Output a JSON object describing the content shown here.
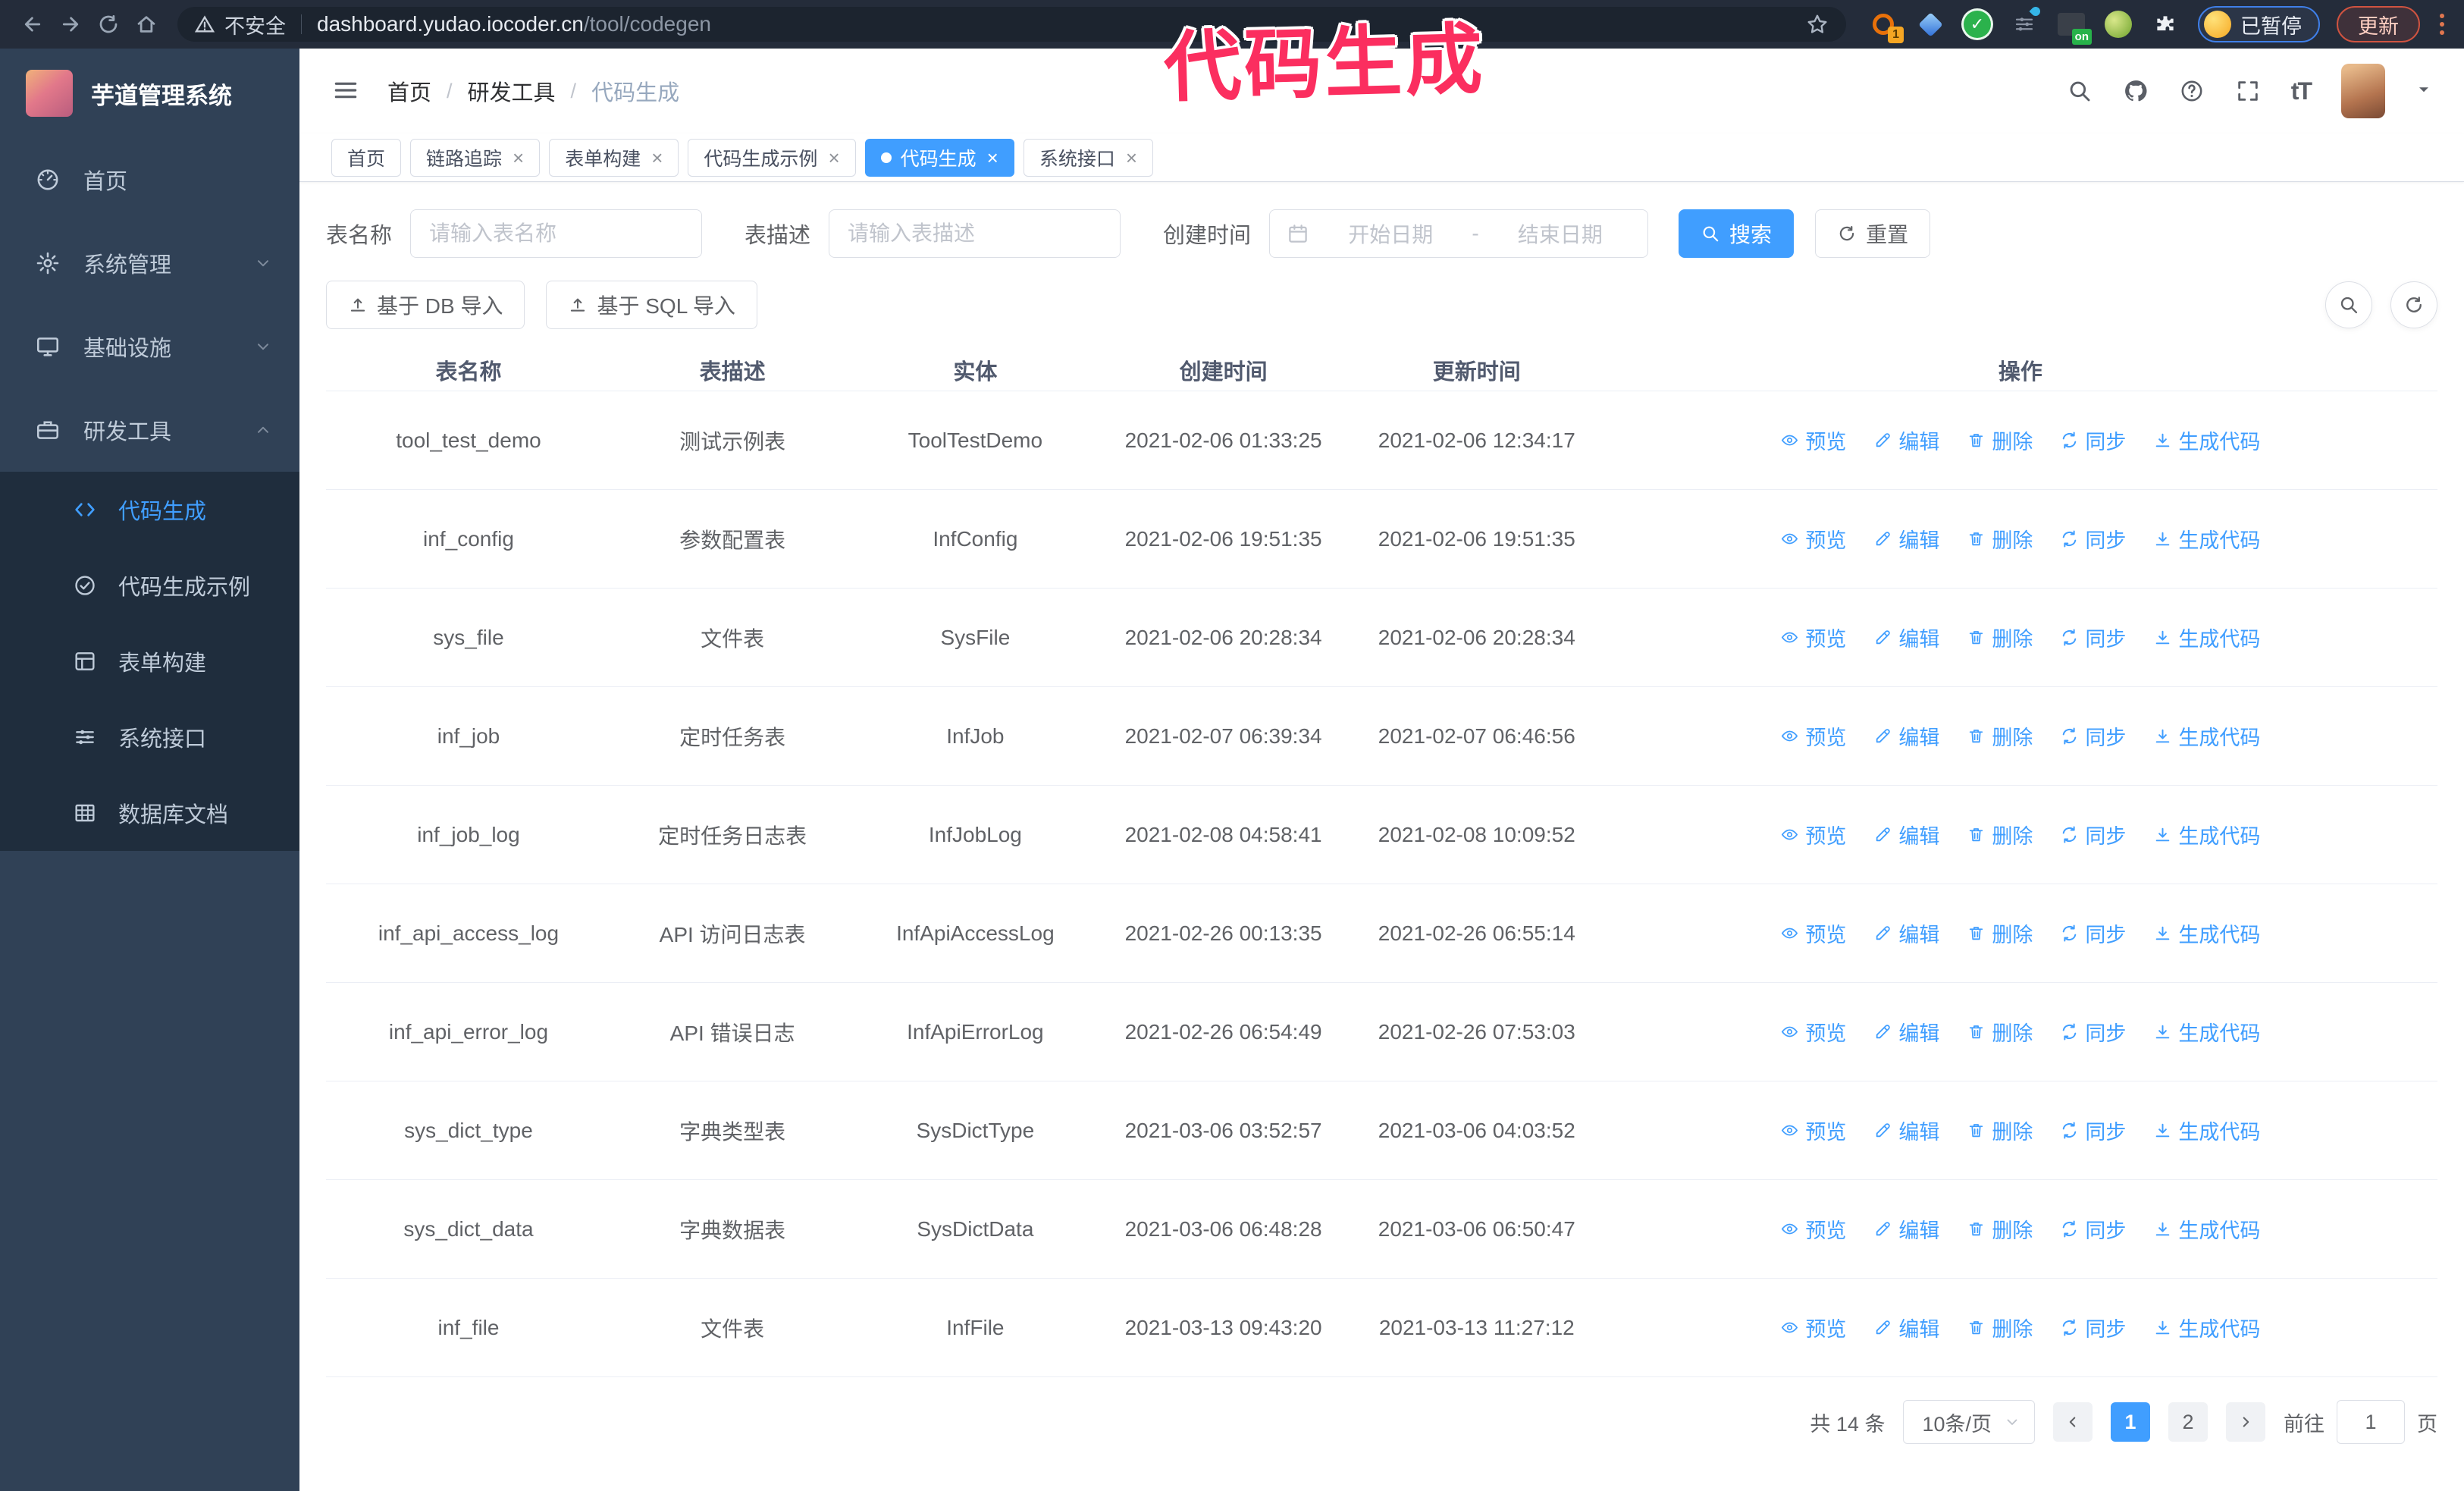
{
  "colors": {
    "accent": "#409eff",
    "sidebar": "#304156",
    "submenu": "#1f2d3d",
    "watermark": "#fb2e5f"
  },
  "watermark": "代码生成",
  "browser": {
    "security_label": "不安全",
    "url_domain": "dashboard.yudao.iocoder.cn",
    "url_path": "/tool/codegen",
    "extension_badge": "1",
    "extension_on_badge": "on",
    "profile_chip_label": "已暂停",
    "update_button_label": "更新"
  },
  "sidebar": {
    "title": "芋道管理系统",
    "items": [
      {
        "label": "首页"
      },
      {
        "label": "系统管理"
      },
      {
        "label": "基础设施"
      },
      {
        "label": "研发工具"
      }
    ],
    "submenu": [
      {
        "label": "代码生成"
      },
      {
        "label": "代码生成示例"
      },
      {
        "label": "表单构建"
      },
      {
        "label": "系统接口"
      },
      {
        "label": "数据库文档"
      }
    ]
  },
  "navbar": {
    "breadcrumb": [
      "首页",
      "研发工具",
      "代码生成"
    ],
    "font_size_icon": "tT"
  },
  "tabs": [
    {
      "label": "首页"
    },
    {
      "label": "链路追踪"
    },
    {
      "label": "表单构建"
    },
    {
      "label": "代码生成示例"
    },
    {
      "label": "代码生成"
    },
    {
      "label": "系统接口"
    }
  ],
  "filters": {
    "name_label": "表名称",
    "name_placeholder": "请输入表名称",
    "desc_label": "表描述",
    "desc_placeholder": "请输入表描述",
    "time_label": "创建时间",
    "start_placeholder": "开始日期",
    "range_separator": "-",
    "end_placeholder": "结束日期",
    "search_label": "搜索",
    "reset_label": "重置"
  },
  "toolbar": {
    "db_import_label": "基于 DB 导入",
    "sql_import_label": "基于 SQL 导入"
  },
  "table": {
    "columns": [
      "表名称",
      "表描述",
      "实体",
      "创建时间",
      "更新时间",
      "操作"
    ],
    "actions": [
      "预览",
      "编辑",
      "删除",
      "同步",
      "生成代码"
    ],
    "rows": [
      {
        "name": "tool_test_demo",
        "desc": "测试示例表",
        "entity": "ToolTestDemo",
        "created": "2021-02-06 01:33:25",
        "updated": "2021-02-06 12:34:17"
      },
      {
        "name": "inf_config",
        "desc": "参数配置表",
        "entity": "InfConfig",
        "created": "2021-02-06 19:51:35",
        "updated": "2021-02-06 19:51:35"
      },
      {
        "name": "sys_file",
        "desc": "文件表",
        "entity": "SysFile",
        "created": "2021-02-06 20:28:34",
        "updated": "2021-02-06 20:28:34"
      },
      {
        "name": "inf_job",
        "desc": "定时任务表",
        "entity": "InfJob",
        "created": "2021-02-07 06:39:34",
        "updated": "2021-02-07 06:46:56"
      },
      {
        "name": "inf_job_log",
        "desc": "定时任务日志表",
        "entity": "InfJobLog",
        "created": "2021-02-08 04:58:41",
        "updated": "2021-02-08 10:09:52"
      },
      {
        "name": "inf_api_access_log",
        "desc": "API 访问日志表",
        "entity": "InfApiAccessLog",
        "created": "2021-02-26 00:13:35",
        "updated": "2021-02-26 06:55:14"
      },
      {
        "name": "inf_api_error_log",
        "desc": "API 错误日志",
        "entity": "InfApiErrorLog",
        "created": "2021-02-26 06:54:49",
        "updated": "2021-02-26 07:53:03"
      },
      {
        "name": "sys_dict_type",
        "desc": "字典类型表",
        "entity": "SysDictType",
        "created": "2021-03-06 03:52:57",
        "updated": "2021-03-06 04:03:52"
      },
      {
        "name": "sys_dict_data",
        "desc": "字典数据表",
        "entity": "SysDictData",
        "created": "2021-03-06 06:48:28",
        "updated": "2021-03-06 06:50:47"
      },
      {
        "name": "inf_file",
        "desc": "文件表",
        "entity": "InfFile",
        "created": "2021-03-13 09:43:20",
        "updated": "2021-03-13 11:27:12"
      }
    ]
  },
  "pagination": {
    "total_label": "共 14 条",
    "page_size_label": "10条/页",
    "pages": [
      "1",
      "2"
    ],
    "active_page": "1",
    "goto_label": "前往",
    "goto_value": "1",
    "goto_unit_label": "页"
  }
}
